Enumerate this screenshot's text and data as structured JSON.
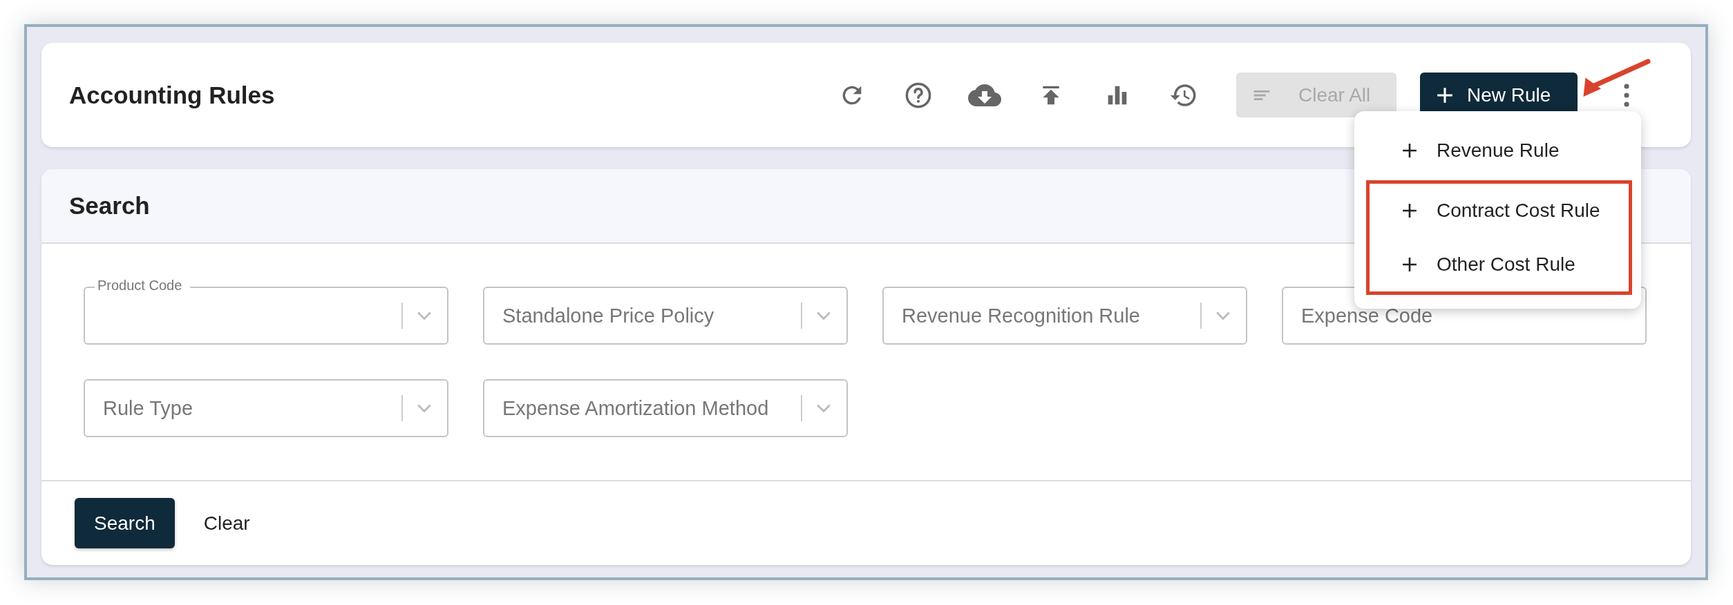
{
  "header": {
    "title": "Accounting Rules",
    "clear_all": {
      "label": "Clear All",
      "disabled": true
    },
    "new_rule": {
      "label": "New Rule",
      "expanded": true
    }
  },
  "new_rule_menu": [
    {
      "label": "Revenue Rule",
      "highlighted": false
    },
    {
      "label": "Contract Cost Rule",
      "highlighted": true
    },
    {
      "label": "Other Cost Rule",
      "highlighted": true
    }
  ],
  "search": {
    "title": "Search",
    "fields": [
      {
        "kind": "select",
        "label": "Product Code"
      },
      {
        "kind": "select",
        "placeholder": "Standalone Price Policy"
      },
      {
        "kind": "select",
        "placeholder": "Revenue Recognition Rule"
      },
      {
        "kind": "text",
        "placeholder": "Expense Code"
      },
      {
        "kind": "select",
        "placeholder": "Rule Type"
      },
      {
        "kind": "select",
        "placeholder": "Expense Amortization Method"
      }
    ],
    "buttons": {
      "search": "Search",
      "clear": "Clear"
    }
  }
}
